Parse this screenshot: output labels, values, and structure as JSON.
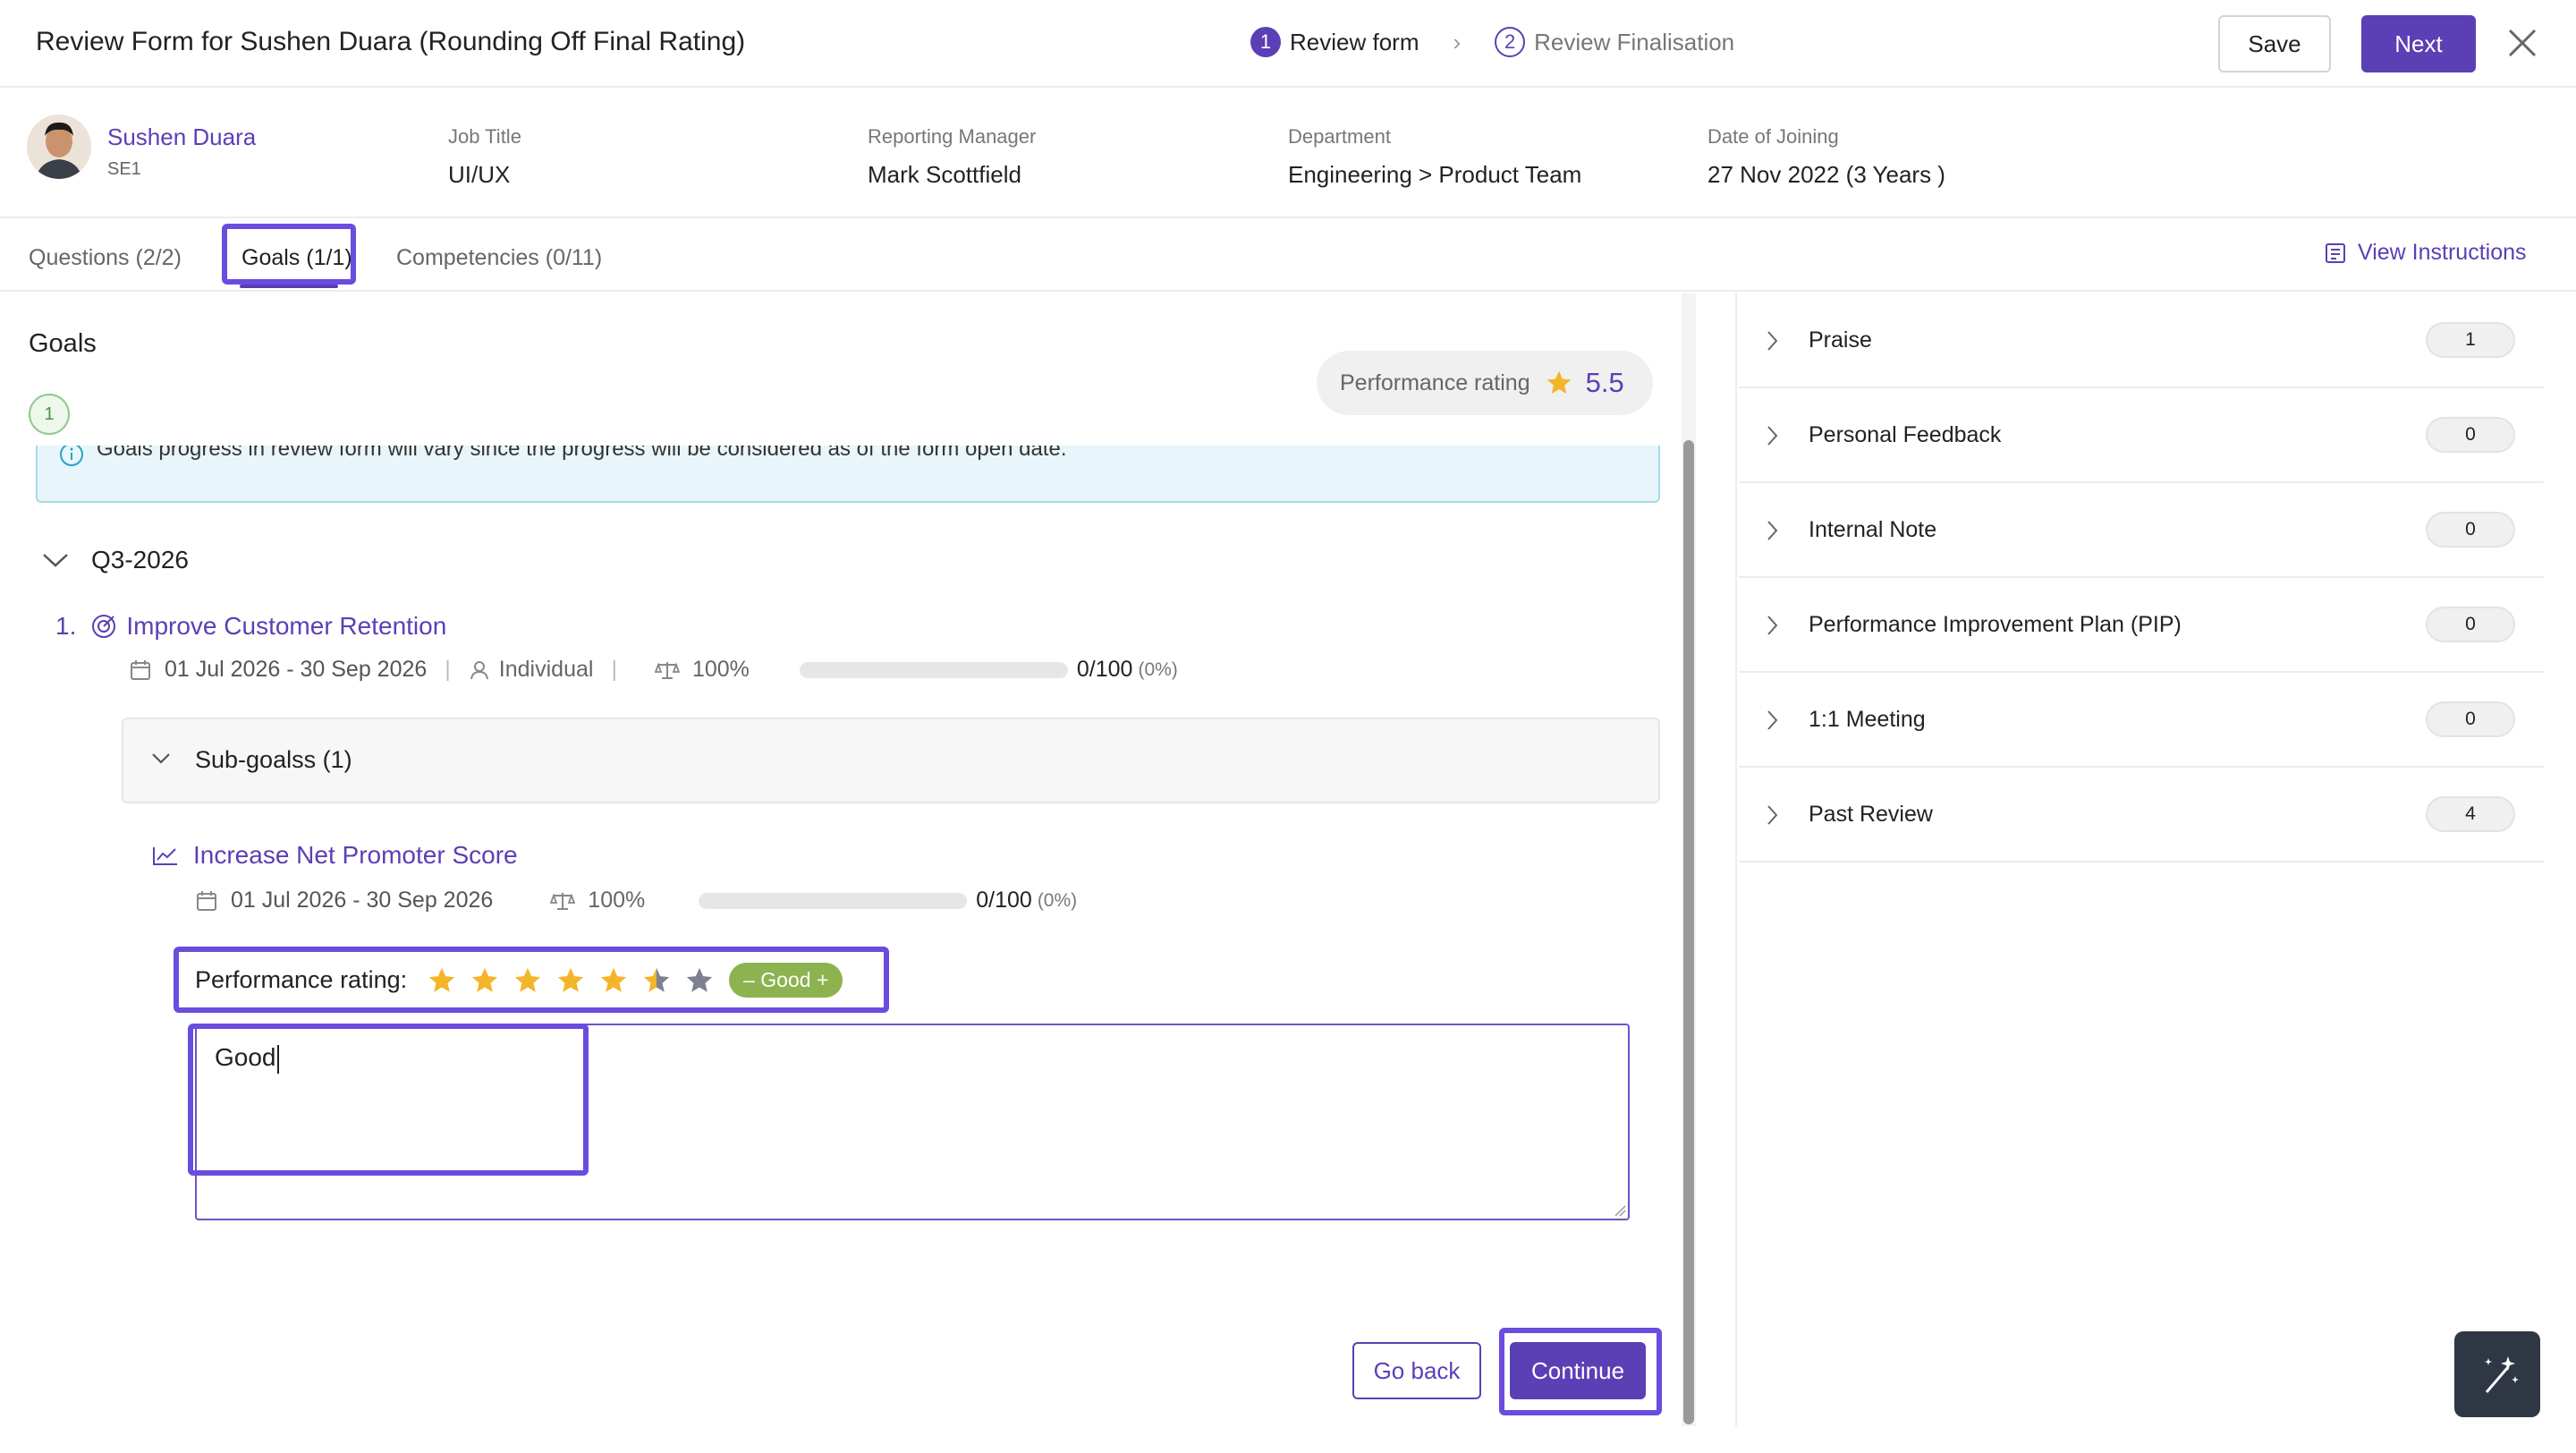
{
  "header": {
    "title": "Review Form for Sushen Duara (Rounding Off Final Rating)",
    "steps": [
      {
        "num": "1",
        "label": "Review form",
        "state": "active"
      },
      {
        "num": "2",
        "label": "Review Finalisation",
        "state": "inactive"
      }
    ],
    "save_label": "Save",
    "next_label": "Next",
    "close_icon": "close-icon"
  },
  "employee": {
    "name": "Sushen Duara",
    "level": "SE1",
    "fields": [
      {
        "label": "Job Title",
        "value": "UI/UX"
      },
      {
        "label": "Reporting Manager",
        "value": "Mark Scottfield"
      },
      {
        "label": "Department",
        "value": "Engineering > Product Team"
      },
      {
        "label": "Date of Joining",
        "value": "27 Nov 2022 (3 Years )"
      }
    ]
  },
  "tabs": [
    {
      "label": "Questions (2/2)"
    },
    {
      "label": "Goals (1/1)"
    },
    {
      "label": "Competencies (0/11)"
    }
  ],
  "view_instructions": "View Instructions",
  "goals": {
    "title": "Goals",
    "count": "1",
    "perf_rating_label": "Performance rating",
    "perf_rating_value": "5.5",
    "banner_text": "Goals progress in review form will vary since the progress will be considered as of the form open date.",
    "quarter": "Q3-2026",
    "goal": {
      "number": "1.",
      "name": "Improve Customer Retention",
      "dates": "01 Jul 2026 - 30 Sep 2026",
      "owner": "Individual",
      "weight": "100%",
      "progress": "0/100",
      "progress_pct": "(0%)",
      "progress_fraction": 0
    },
    "subgoals_label": "Sub-goalss (1)",
    "subgoal": {
      "name": "Increase Net Promoter Score",
      "dates": "01 Jul 2026 - 30 Sep 2026",
      "weight": "100%",
      "progress": "0/100",
      "progress_pct": "(0%)",
      "progress_fraction": 0
    },
    "rating_label": "Performance rating:",
    "rating_stars": 5.5,
    "rating_max": 7,
    "rating_badge": "– Good +",
    "comment": "Good",
    "go_back_label": "Go back",
    "continue_label": "Continue"
  },
  "right_panel": [
    {
      "label": "Praise",
      "count": "1"
    },
    {
      "label": "Personal Feedback",
      "count": "0"
    },
    {
      "label": "Internal Note",
      "count": "0"
    },
    {
      "label": "Performance Improvement Plan (PIP)",
      "count": "0"
    },
    {
      "label": "1:1 Meeting",
      "count": "0"
    },
    {
      "label": "Past Review",
      "count": "4"
    }
  ],
  "colors": {
    "accent": "#5b3fb5",
    "highlight": "#6a4cde",
    "star": "#f3b529",
    "star_empty": "#7b8190",
    "good_badge": "#8cb34f"
  }
}
